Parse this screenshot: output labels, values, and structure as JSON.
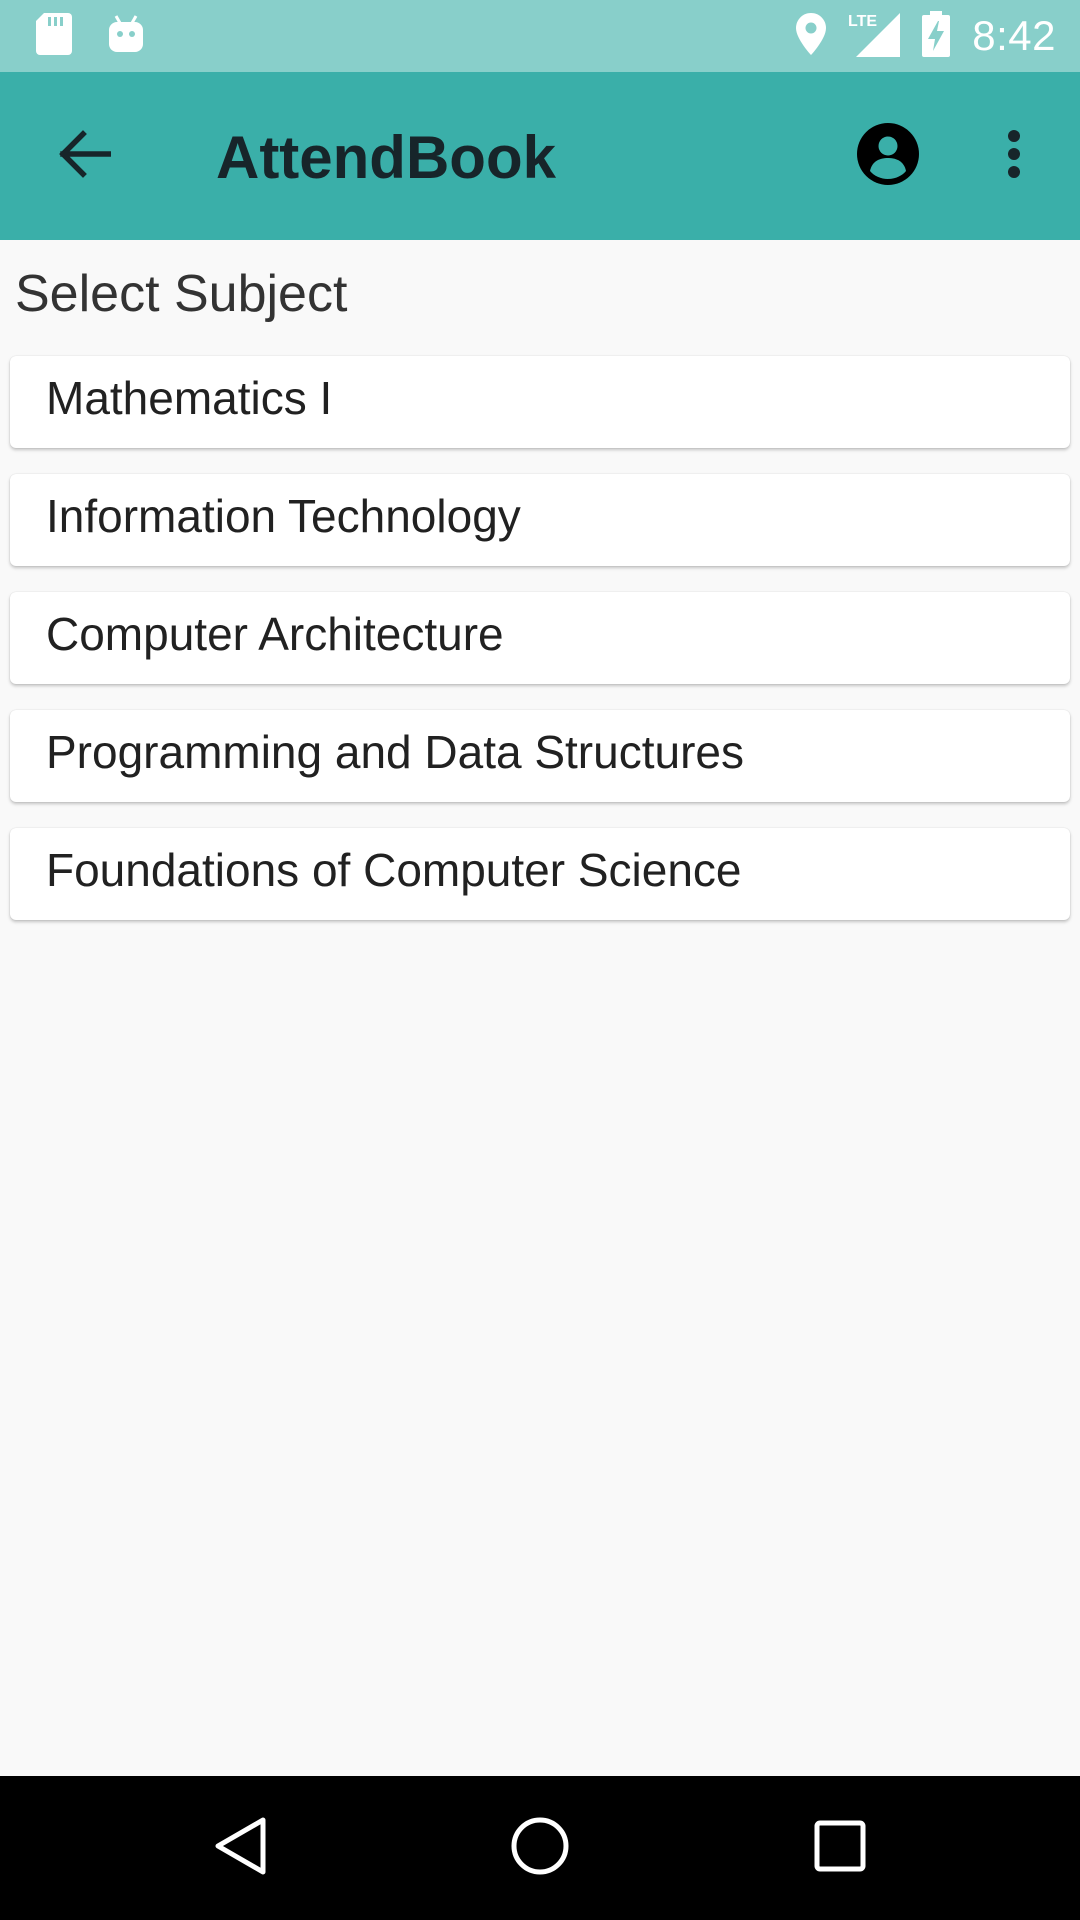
{
  "status_bar": {
    "time": "8:42",
    "network_label": "LTE",
    "icons": [
      "sd-card-icon",
      "android-icon",
      "location-icon",
      "signal-icon",
      "battery-charging-icon"
    ]
  },
  "app_bar": {
    "title": "AttendBook",
    "icons": [
      "back-arrow-icon",
      "account-circle-icon",
      "more-vert-icon"
    ]
  },
  "main": {
    "section_title": "Select Subject",
    "subjects": [
      {
        "label": "Mathematics I"
      },
      {
        "label": "Information Technology"
      },
      {
        "label": "Computer Architecture"
      },
      {
        "label": "Programming and Data Structures"
      },
      {
        "label": "Foundations of Computer Science"
      }
    ]
  },
  "nav_bar": {
    "icons": [
      "back-triangle-icon",
      "home-circle-icon",
      "recents-square-icon"
    ]
  },
  "colors": {
    "status_bar": "#88cfca",
    "app_bar": "#3aafa9",
    "title_text": "#17252a",
    "background": "#f9f9f9"
  }
}
